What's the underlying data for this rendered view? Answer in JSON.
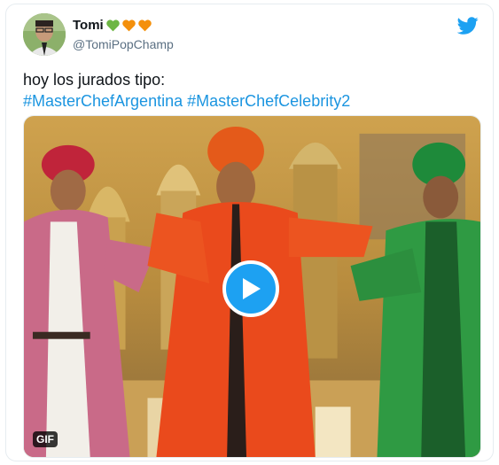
{
  "tweet": {
    "author_name": "Tomi",
    "author_handle": "@TomiPopChamp",
    "name_emojis": [
      "green-heart",
      "orange-heart",
      "orange-heart"
    ],
    "text_line": "hoy los jurados tipo:",
    "hashtags": [
      "#MasterChefArgentina",
      "#MasterChefCelebrity2"
    ],
    "media": {
      "badge": "GIF"
    }
  },
  "colors": {
    "hashtag": "#1b95e0",
    "twitter_blue": "#1da1f2",
    "handle_gray": "#5b7083",
    "green_heart": "#6db644",
    "orange_heart": "#f4900c"
  }
}
